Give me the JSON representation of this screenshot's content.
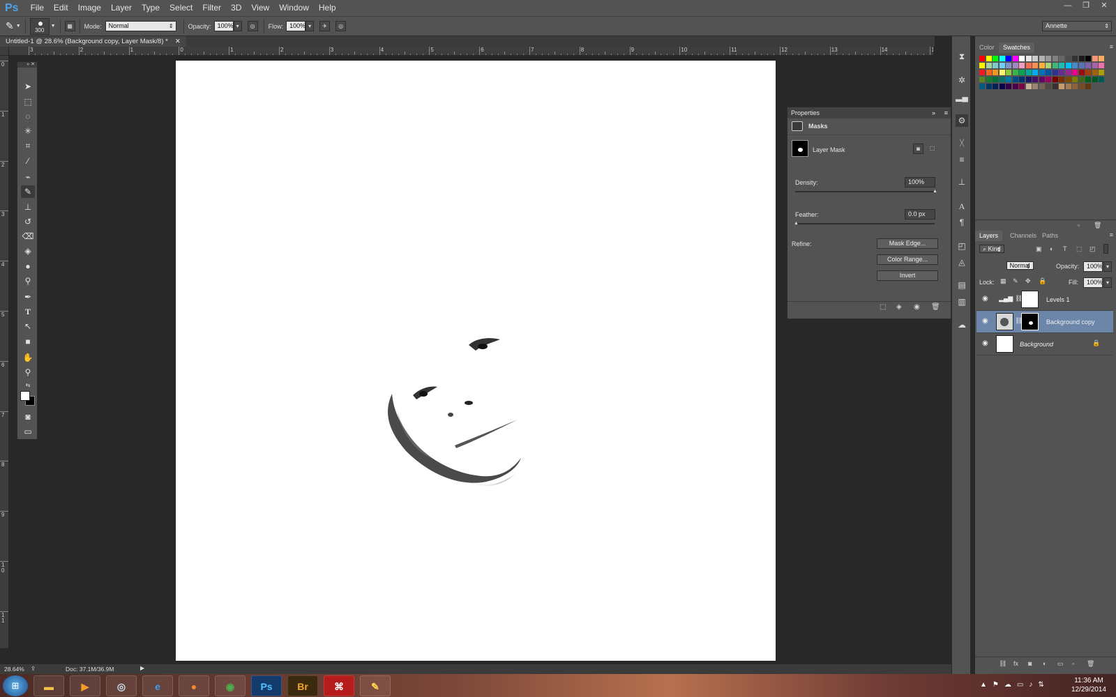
{
  "app": {
    "logo": "Ps",
    "user": "Annette"
  },
  "menu": [
    "File",
    "Edit",
    "Image",
    "Layer",
    "Type",
    "Select",
    "Filter",
    "3D",
    "View",
    "Window",
    "Help"
  ],
  "window_controls": [
    "—",
    "❐",
    "✕"
  ],
  "options": {
    "brush_size": "300",
    "mode_label": "Mode:",
    "mode_value": "Normal",
    "opacity_label": "Opacity:",
    "opacity_value": "100%",
    "flow_label": "Flow:",
    "flow_value": "100%"
  },
  "document": {
    "tab_title": "Untitled-1 @ 28.6% (Background copy, Layer Mask/8) *",
    "close": "✕"
  },
  "ruler": {
    "h_labels": [
      "3",
      "2",
      "1",
      "0",
      "1",
      "2",
      "3",
      "4",
      "5",
      "6",
      "7",
      "8",
      "9",
      "10",
      "11",
      "12",
      "13",
      "14",
      "15"
    ],
    "v_labels": [
      "0",
      "1",
      "2",
      "3",
      "4",
      "5",
      "6",
      "7",
      "8",
      "9",
      "1 0",
      "1 1"
    ]
  },
  "properties": {
    "title": "Properties",
    "section": "Masks",
    "mask_label": "Layer Mask",
    "density_label": "Density:",
    "density_value": "100%",
    "feather_label": "Feather:",
    "feather_value": "0.0 px",
    "refine_label": "Refine:",
    "buttons": [
      "Mask Edge...",
      "Color Range...",
      "Invert"
    ]
  },
  "swatch_panel": {
    "tabs": [
      "Color",
      "Swatches"
    ]
  },
  "swatch_colors": [
    "#ff0000",
    "#ffff00",
    "#00ff00",
    "#00ffff",
    "#0000ff",
    "#ff00ff",
    "#ffffff",
    "#e6e6e6",
    "#cccccc",
    "#b3b3b3",
    "#999999",
    "#808080",
    "#666666",
    "#4d4d4d",
    "#333333",
    "#1a1a1a",
    "#000000",
    "#f69679",
    "#fbaf5d",
    "#fff200",
    "#a3d39c",
    "#7accc8",
    "#6dcff6",
    "#8393ca",
    "#a187be",
    "#f49ac2",
    "#f26c4f",
    "#f68e55",
    "#fbb040",
    "#acd373",
    "#3cb878",
    "#1cbbb4",
    "#00bff3",
    "#438ccb",
    "#5674b9",
    "#855fa8",
    "#a763a8",
    "#f06ea9",
    "#ed1c24",
    "#f26522",
    "#f7941d",
    "#fff568",
    "#8dc63f",
    "#39b54a",
    "#00a651",
    "#00a99d",
    "#00aeef",
    "#0072bc",
    "#0054a6",
    "#2e3192",
    "#662d91",
    "#92278f",
    "#ec008c",
    "#9e0b0f",
    "#a0410d",
    "#a36209",
    "#aba000",
    "#598527",
    "#197b30",
    "#007236",
    "#00746b",
    "#0076a3",
    "#004b80",
    "#003471",
    "#1b1464",
    "#440e62",
    "#630460",
    "#9e005d",
    "#790000",
    "#7b2e00",
    "#7d4900",
    "#827b00",
    "#406618",
    "#005e20",
    "#005826",
    "#005952",
    "#005b7f",
    "#003663",
    "#002157",
    "#0d004c",
    "#32004b",
    "#4b0049",
    "#7b0046",
    "#c7b299",
    "#998675",
    "#736357",
    "#534741",
    "#37302d",
    "#c69c6d",
    "#a67c52",
    "#8c6239",
    "#754c24",
    "#603913"
  ],
  "layers_panel": {
    "tabs": [
      "Layers",
      "Channels",
      "Paths"
    ],
    "kind": "Kind",
    "blend": "Normal",
    "opacity_label": "Opacity:",
    "opacity_value": "100%",
    "lock_label": "Lock:",
    "fill_label": "Fill:",
    "fill_value": "100%"
  },
  "layers": [
    {
      "name": "Levels 1"
    },
    {
      "name": "Background copy"
    },
    {
      "name": "Background"
    }
  ],
  "status": {
    "zoom": "28.64%",
    "doc": "Doc: 37.1M/36.9M"
  },
  "taskbar": {
    "apps": [
      "Ps",
      "Br"
    ],
    "time": "11:36 AM",
    "date": "12/29/2014"
  }
}
